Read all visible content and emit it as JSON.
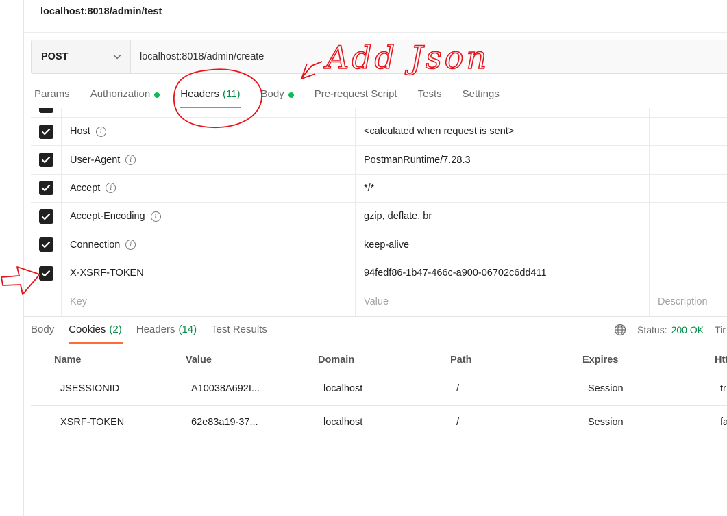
{
  "window": {
    "title": "localhost:8018/admin/test"
  },
  "request": {
    "method": "POST",
    "url": "localhost:8018/admin/create"
  },
  "request_tabs": [
    {
      "label": "Params",
      "count": "",
      "dot": false
    },
    {
      "label": "Authorization",
      "count": "",
      "dot": true
    },
    {
      "label": "Headers",
      "count": "(11)",
      "dot": false,
      "active": true
    },
    {
      "label": "Body",
      "count": "",
      "dot": true
    },
    {
      "label": "Pre-request Script",
      "count": "",
      "dot": false
    },
    {
      "label": "Tests",
      "count": "",
      "dot": false
    },
    {
      "label": "Settings",
      "count": "",
      "dot": false
    }
  ],
  "headers": {
    "rows": [
      {
        "key": "Host",
        "value": "<calculated when request is sent>",
        "checked": true,
        "info": true
      },
      {
        "key": "User-Agent",
        "value": "PostmanRuntime/7.28.3",
        "checked": true,
        "info": true
      },
      {
        "key": "Accept",
        "value": "*/*",
        "checked": true,
        "info": true
      },
      {
        "key": "Accept-Encoding",
        "value": "gzip, deflate, br",
        "checked": true,
        "info": true
      },
      {
        "key": "Connection",
        "value": "keep-alive",
        "checked": true,
        "info": true
      },
      {
        "key": "X-XSRF-TOKEN",
        "value": "94fedf86-1b47-466c-a900-06702c6dd411",
        "checked": true,
        "info": false
      }
    ],
    "placeholders": {
      "key": "Key",
      "value": "Value",
      "description": "Description"
    }
  },
  "response_tabs": [
    {
      "label": "Body",
      "count": ""
    },
    {
      "label": "Cookies",
      "count": "(2)",
      "active": true
    },
    {
      "label": "Headers",
      "count": "(14)"
    },
    {
      "label": "Test Results",
      "count": ""
    }
  ],
  "status": {
    "label": "Status:",
    "value": "200 OK",
    "time_partial": "Tir"
  },
  "cookies": {
    "columns": [
      "Name",
      "Value",
      "Domain",
      "Path",
      "Expires",
      "Htt"
    ],
    "rows": [
      [
        "JSESSIONID",
        "A10038A692I...",
        "localhost",
        "/",
        "Session",
        "tr"
      ],
      [
        "XSRF-TOKEN",
        "62e83a19-37...",
        "localhost",
        "/",
        "Session",
        "fa"
      ]
    ]
  },
  "annotation": {
    "text": "Add Json",
    "color": "#e8141c"
  },
  "colors": {
    "accent": "#ff6c37",
    "green": "#0a8a4a",
    "dot": "#0cbb52"
  }
}
